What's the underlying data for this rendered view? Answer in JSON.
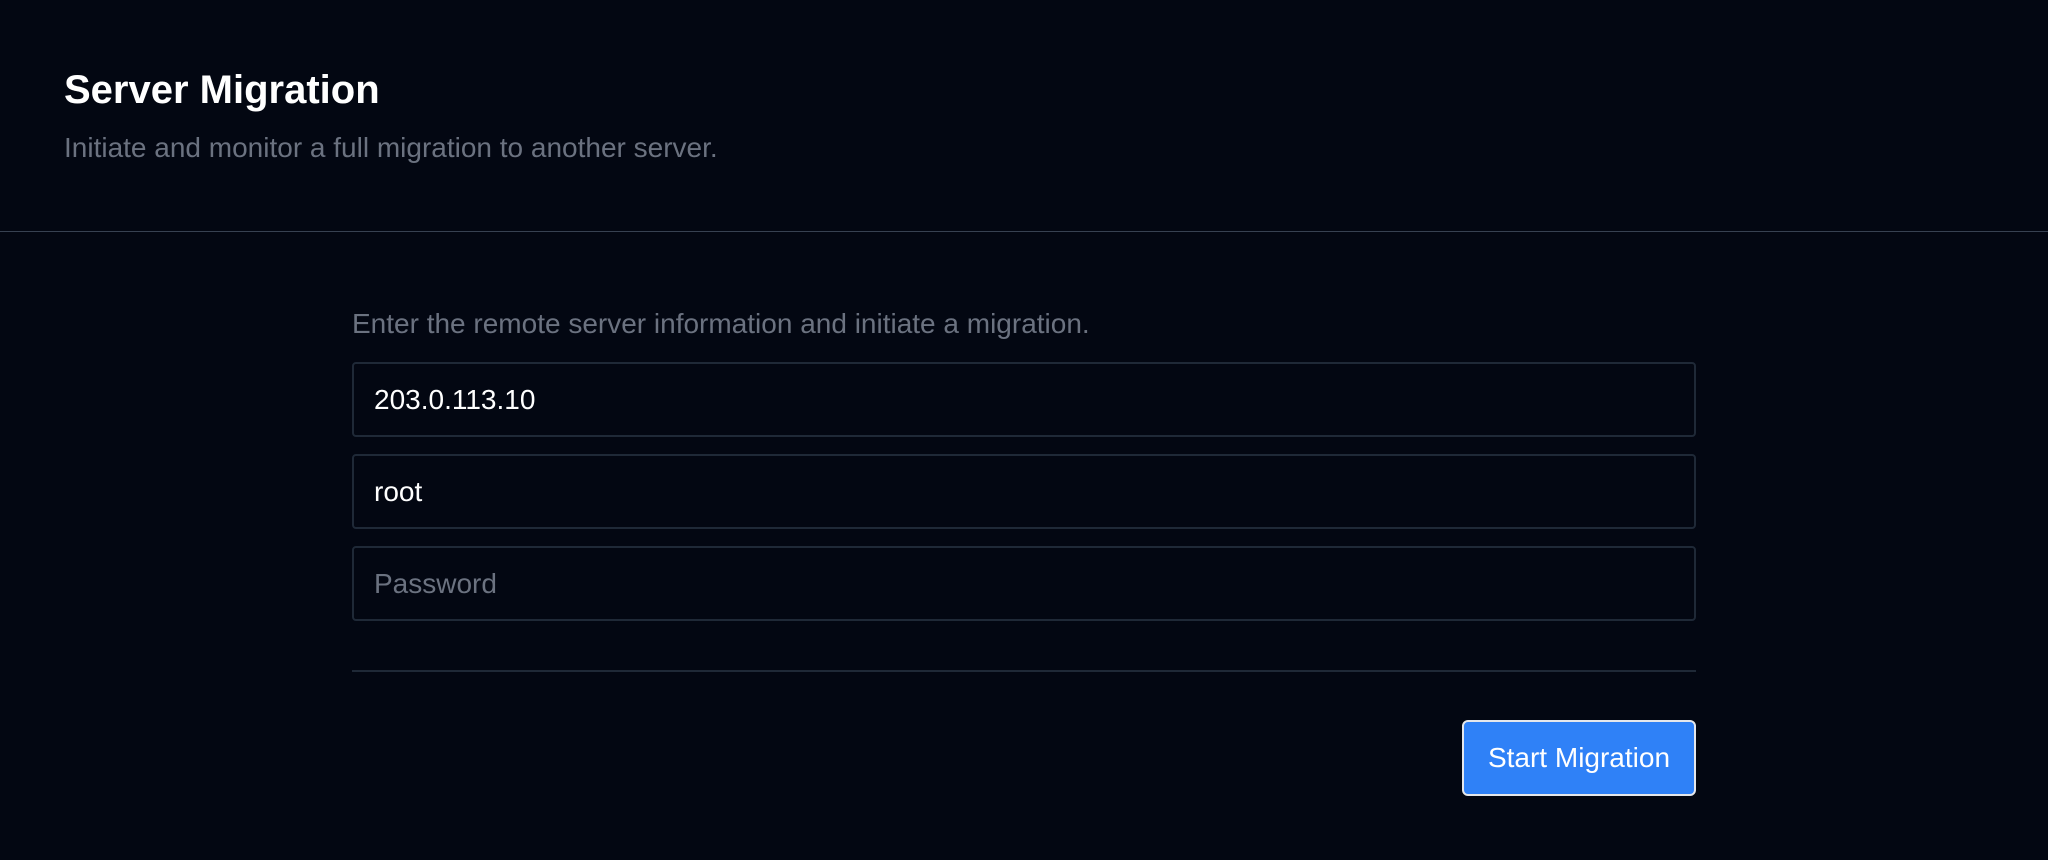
{
  "header": {
    "title": "Server Migration",
    "subtitle": "Initiate and monitor a full migration to another server."
  },
  "form": {
    "instructions": "Enter the remote server information and initiate a migration.",
    "host": {
      "value": "203.0.113.10"
    },
    "username": {
      "value": "root"
    },
    "password": {
      "value": "",
      "placeholder": "Password"
    },
    "start_label": "Start Migration"
  },
  "colors": {
    "background": "#030712",
    "accent": "#2f81f7",
    "muted_text": "#6b7280",
    "border": "#1f2937"
  }
}
